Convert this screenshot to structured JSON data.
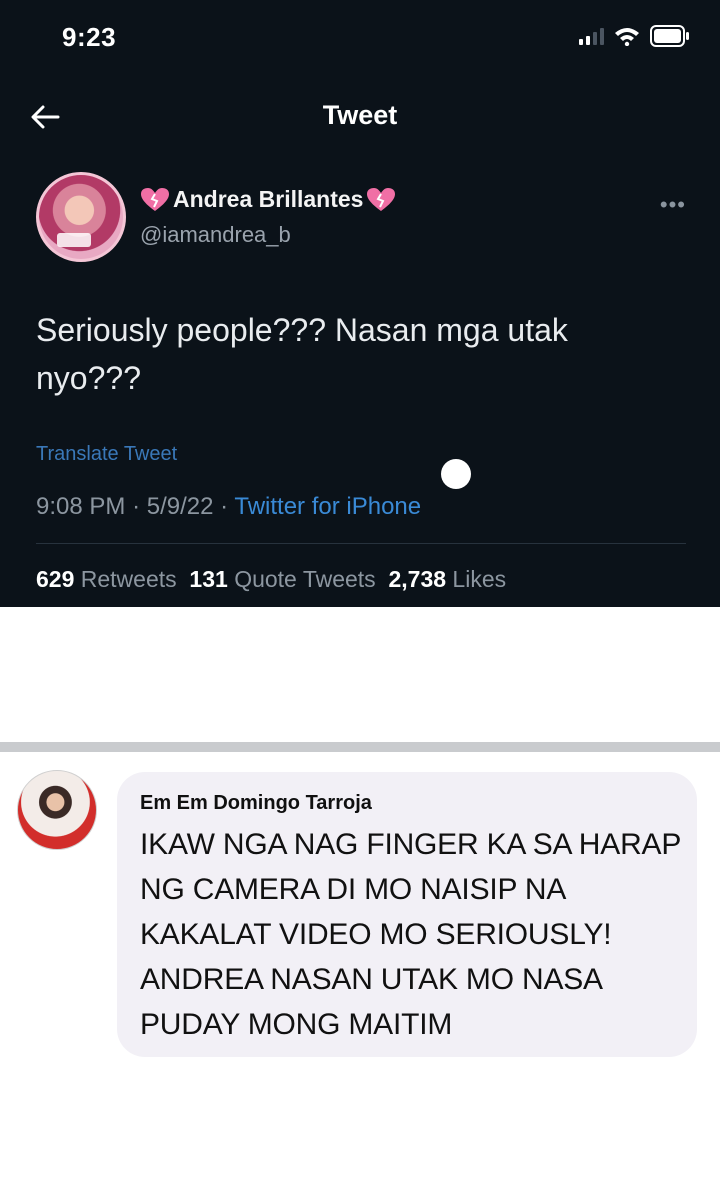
{
  "tweet": {
    "status_bar": {
      "time": "9:23",
      "icons": [
        "signal-icon",
        "wifi-icon",
        "battery-icon"
      ]
    },
    "nav": {
      "back_icon": "arrow-left-icon",
      "title": "Tweet"
    },
    "author": {
      "display_name": "Andrea Brillantes",
      "handle": "@iamandrea_b",
      "name_decoration_icon": "heart-icon",
      "more_icon": "more-horizontal-icon"
    },
    "text": "Seriously people??? Nasan mga utak nyo???",
    "translate_label": "Translate Tweet",
    "meta": {
      "time": "9:08 PM",
      "separator": "·",
      "date": "5/9/22",
      "source": "Twitter for iPhone"
    },
    "stats": {
      "retweets_count": "629",
      "retweets_label": "Retweets",
      "quotes_count": "131",
      "quotes_label": "Quote Tweets",
      "likes_count": "2,738",
      "likes_label": "Likes"
    }
  },
  "comment": {
    "author": "Em Em Domingo Tarroja",
    "text": "IKAW NGA NAG FINGER KA SA HARAP NG CAMERA DI MO NAISIP NA KAKALAT VIDEO MO SERIOUSLY! ANDREA NASAN UTAK MO NASA PUDAY MONG MAITIM"
  },
  "colors": {
    "tweet_background": "#0b1219",
    "link_blue": "#3a8ad6",
    "bubble_background": "#f2f0f6",
    "band_gray": "#c9cbce"
  }
}
